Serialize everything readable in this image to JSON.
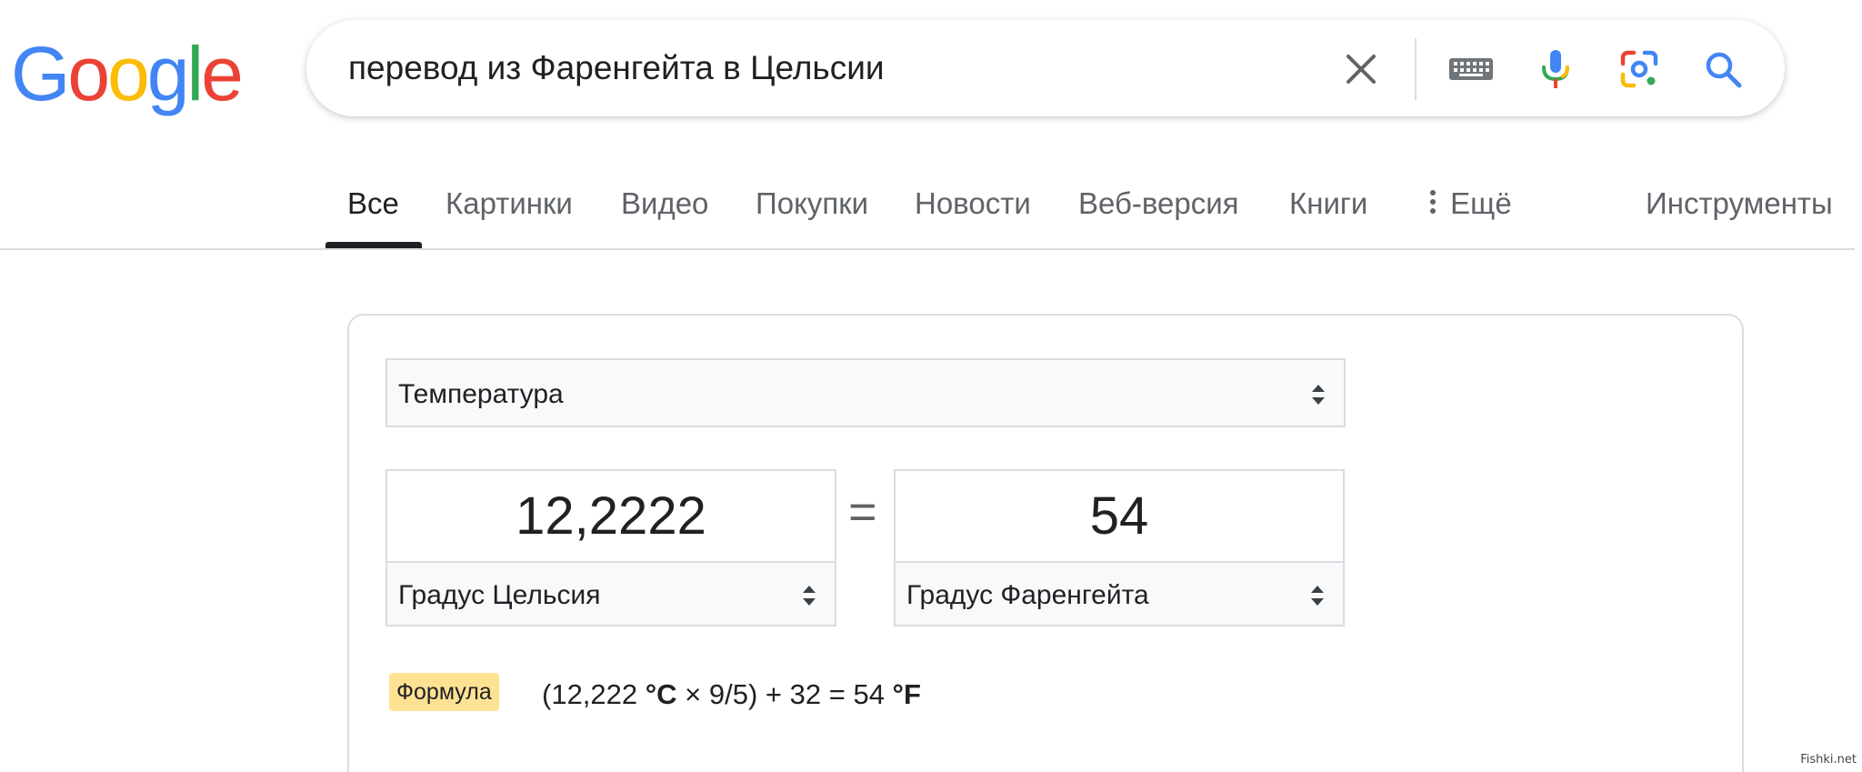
{
  "logo": {
    "letters": [
      "G",
      "o",
      "o",
      "g",
      "l",
      "e"
    ],
    "colors": [
      "#4285f4",
      "#ea4335",
      "#fbbc05",
      "#4285f4",
      "#34a853",
      "#ea4335"
    ]
  },
  "search": {
    "query": "перевод из Фаренгейта в Цельсии",
    "icons": [
      "close-icon",
      "keyboard-icon",
      "microphone-icon",
      "lens-icon",
      "search-icon"
    ]
  },
  "tabs": [
    {
      "label": "Все",
      "active": true
    },
    {
      "label": "Картинки"
    },
    {
      "label": "Видео"
    },
    {
      "label": "Покупки"
    },
    {
      "label": "Новости"
    },
    {
      "label": "Веб-версия"
    },
    {
      "label": "Книги"
    },
    {
      "label": "Ещё"
    },
    {
      "label": "Инструменты"
    }
  ],
  "converter": {
    "category": "Температура",
    "left_value": "12,2222",
    "equals": "=",
    "right_value": "54",
    "left_unit": "Градус Цельсия",
    "right_unit": "Градус Фаренгейта",
    "formula_badge": "Формула",
    "formula_open": "(12,222 ",
    "formula_unit_c": "°C",
    "formula_mid": " × 9/5) + 32 = 54 ",
    "formula_unit_f": "°F"
  },
  "watermark": "Fishki.net",
  "colors": {
    "tab_active": "#202124",
    "tab_inactive": "#5f6368",
    "formula_badge_bg": "#fde293",
    "border": "#dadce0"
  }
}
